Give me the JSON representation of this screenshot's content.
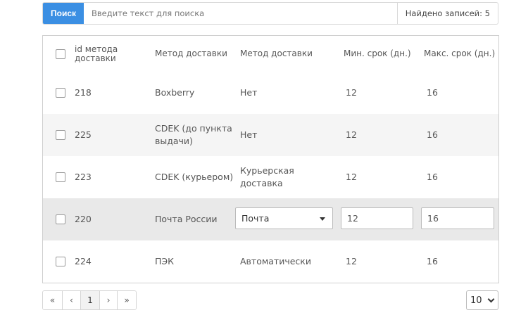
{
  "search": {
    "button_label": "Поиск",
    "placeholder": "Введите текст для поиска",
    "value": "",
    "count_label": "Найдено записей: 5"
  },
  "table": {
    "columns": [
      "id метода доставки",
      "Метод доставки",
      "Метод доставки",
      "Мин. срок (дн.)",
      "Макс. срок (дн.)"
    ],
    "rows": [
      {
        "id": "218",
        "name": "Boxberry",
        "method": "Нет",
        "min": "12",
        "max": "16"
      },
      {
        "id": "225",
        "name": "CDEK (до пункта выдачи)",
        "method": "Нет",
        "min": "12",
        "max": "16"
      },
      {
        "id": "223",
        "name": "CDEK (курьером)",
        "method": "Курьерская доставка",
        "min": "12",
        "max": "16"
      },
      {
        "id": "220",
        "name": "Почта России",
        "method": "Почта",
        "min": "12",
        "max": "16",
        "editing": true
      },
      {
        "id": "224",
        "name": "ПЭК",
        "method": "Автоматически",
        "min": "12",
        "max": "16"
      }
    ]
  },
  "pagination": {
    "first": "«",
    "prev": "‹",
    "current": "1",
    "next": "›",
    "last": "»"
  },
  "per_page": {
    "selected": "10"
  },
  "colors": {
    "accent": "#3b8fe3",
    "row_alt": "#f5f5f5",
    "row_editing": "#e9e9e9"
  }
}
